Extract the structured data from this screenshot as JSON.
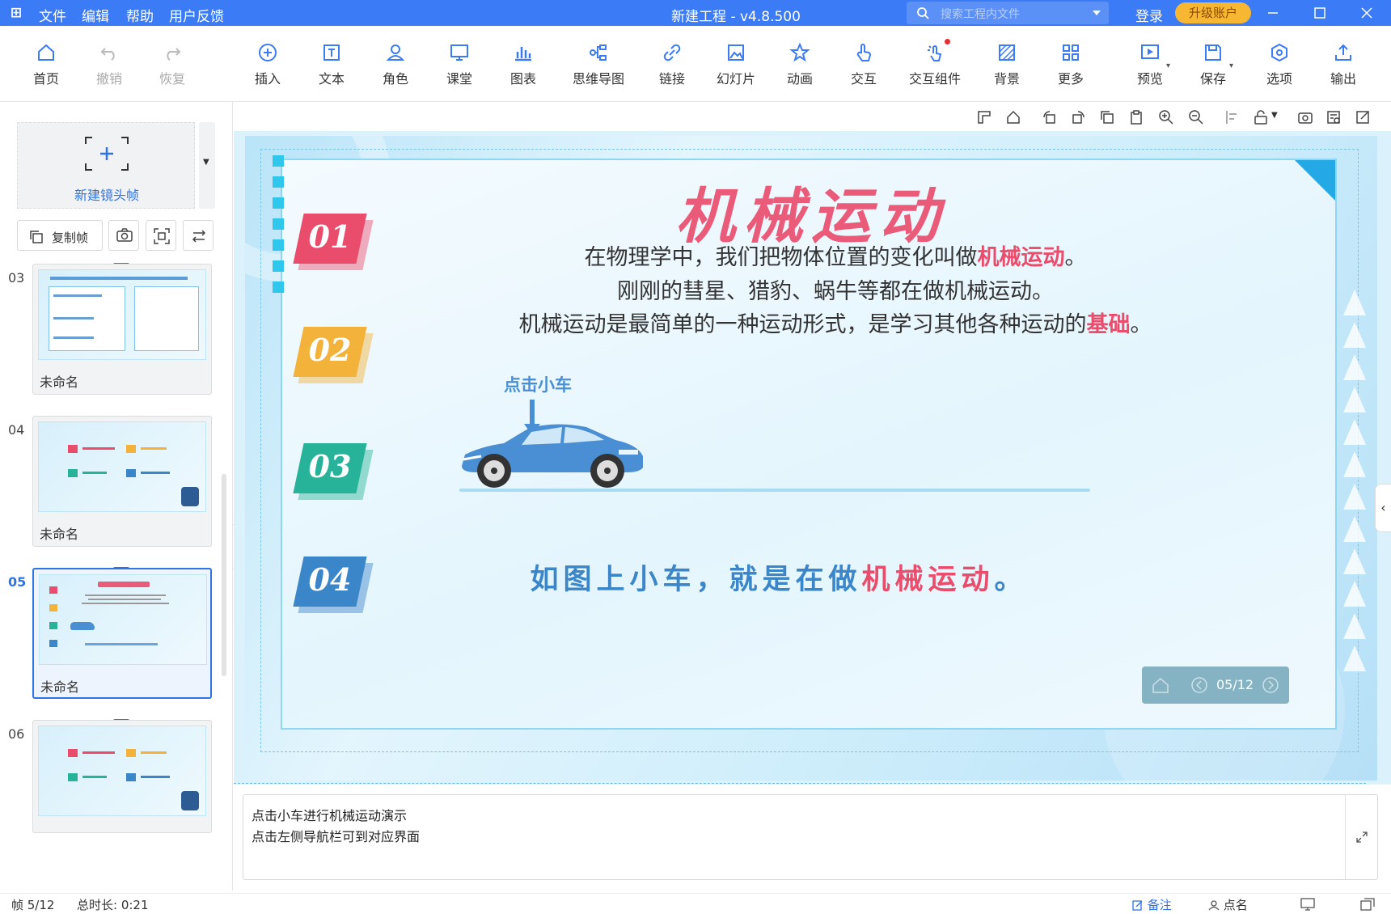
{
  "titlebar": {
    "menu": [
      "文件",
      "编辑",
      "帮助",
      "用户反馈"
    ],
    "title": "新建工程 - v4.8.500",
    "search_placeholder": "搜索工程内文件",
    "login": "登录",
    "upgrade": "升级账户"
  },
  "toolbar": {
    "items": [
      "首页",
      "撤销",
      "恢复",
      "插入",
      "文本",
      "角色",
      "课堂",
      "图表",
      "思维导图",
      "链接",
      "幻灯片",
      "动画",
      "交互",
      "交互组件",
      "背景",
      "更多",
      "预览",
      "保存",
      "选项",
      "输出"
    ]
  },
  "left_panel": {
    "new_frame": "新建镜头帧",
    "copy_frame": "复制帧",
    "thumbnails": [
      {
        "num": "03",
        "caption": "未命名"
      },
      {
        "num": "04",
        "caption": "未命名"
      },
      {
        "num": "05",
        "caption": "未命名",
        "selected": true
      },
      {
        "num": "06",
        "caption": ""
      }
    ]
  },
  "slide": {
    "title": "机械运动",
    "tags": [
      "01",
      "02",
      "03",
      "04"
    ],
    "line1_a": "在物理学中，我们把物体位置的变化叫做",
    "line1_hl": "机械运动",
    "line1_b": "。",
    "line2": "刚刚的彗星、猎豹、蜗牛等都在做机械运动。",
    "line3_a": "机械运动是最简单的一种运动形式，是学习其他各种运动的",
    "line3_hl": "基础",
    "line3_b": "。",
    "click_car": "点击小车",
    "bottom_a": "如图上小车，就是在做",
    "bottom_hl": "机械运动",
    "bottom_b": "。",
    "pager": "05/12"
  },
  "notes": {
    "line1": "点击小车进行机械运动演示",
    "line2": "点击左侧导航栏可到对应界面"
  },
  "status": {
    "frame": "帧 5/12",
    "duration": "总时长: 0:21",
    "remarks": "备注",
    "rollcall": "点名"
  },
  "colors": {
    "accent": "#3c7bf6",
    "tag01": "#ea4c6c",
    "tag02": "#f3b23a",
    "tag03": "#27b39a",
    "tag04": "#3b86c9",
    "highlight": "#ea4c6c"
  }
}
